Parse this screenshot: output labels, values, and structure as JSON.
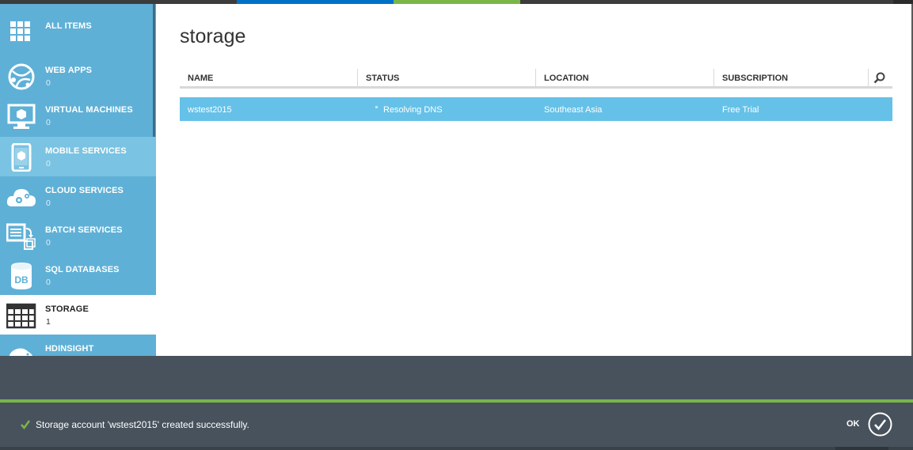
{
  "sidebar": {
    "items": [
      {
        "label": "ALL ITEMS",
        "count": "",
        "icon": "grid-icon"
      },
      {
        "label": "WEB APPS",
        "count": "0",
        "icon": "globe-icon"
      },
      {
        "label": "VIRTUAL MACHINES",
        "count": "0",
        "icon": "monitor-icon"
      },
      {
        "label": "MOBILE SERVICES",
        "count": "0",
        "icon": "phone-icon"
      },
      {
        "label": "CLOUD SERVICES",
        "count": "0",
        "icon": "cloud-gear-icon"
      },
      {
        "label": "BATCH SERVICES",
        "count": "0",
        "icon": "batch-icon"
      },
      {
        "label": "SQL DATABASES",
        "count": "0",
        "icon": "database-icon"
      },
      {
        "label": "STORAGE",
        "count": "1",
        "icon": "storage-table-icon"
      },
      {
        "label": "HDINSIGHT",
        "count": "",
        "icon": "elephant-icon"
      }
    ]
  },
  "main": {
    "title": "storage",
    "columns": [
      "NAME",
      "STATUS",
      "LOCATION",
      "SUBSCRIPTION"
    ],
    "rows": [
      {
        "name": "wstest2015",
        "status": "Resolving DNS",
        "location": "Southeast Asia",
        "subscription": "Free Trial"
      }
    ]
  },
  "notification": {
    "message": "Storage account 'wstest2015' created successfully.",
    "ok_label": "OK"
  },
  "colors": {
    "sidebar": "#5fb0d6",
    "selected_row": "#66c1e8",
    "success": "#7ab648",
    "notification_bg": "#48525c"
  }
}
